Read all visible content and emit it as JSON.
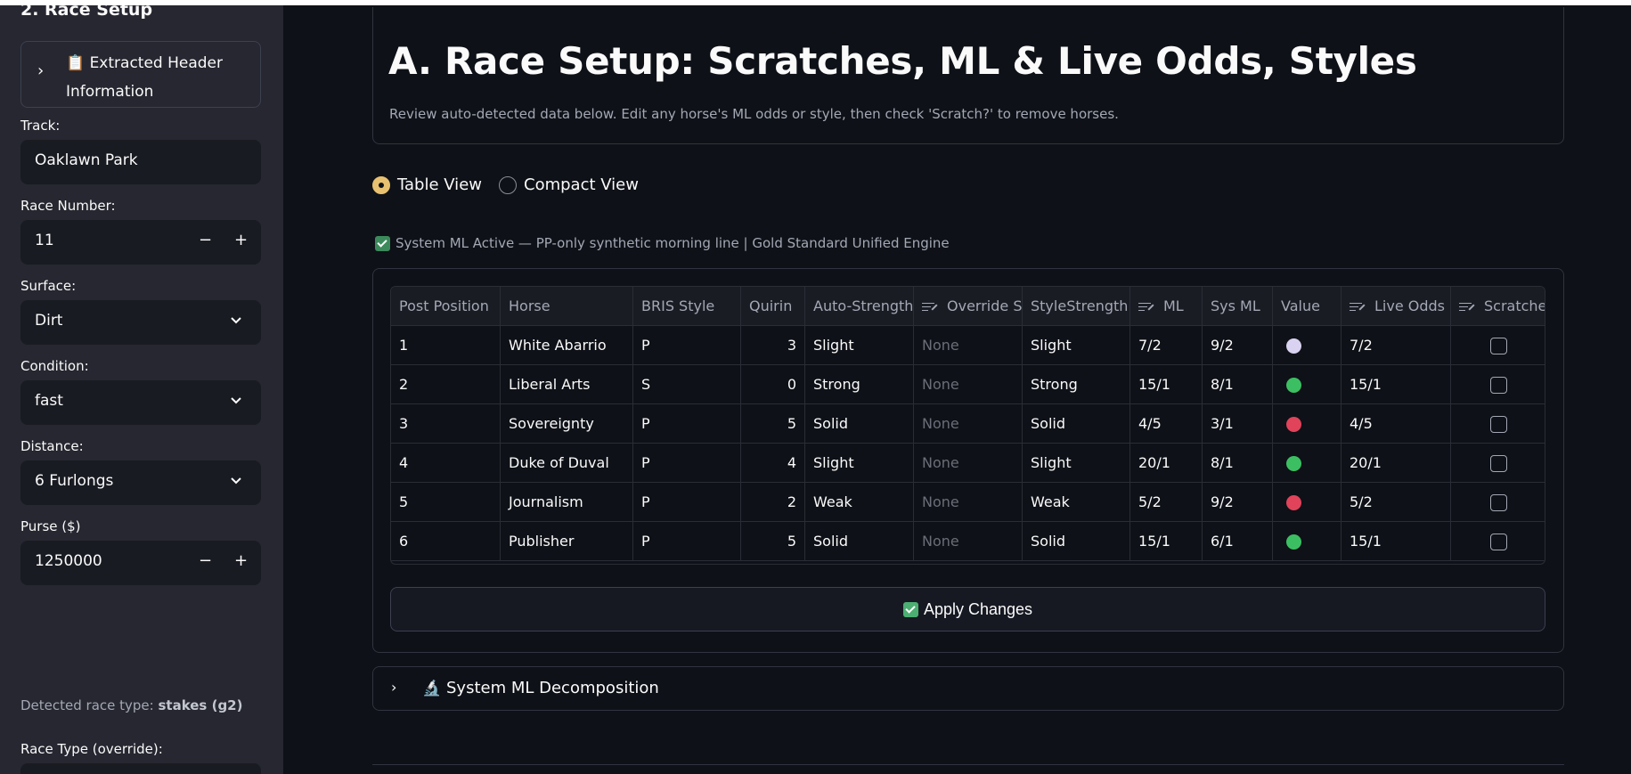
{
  "sidebar": {
    "heading": "2. Race Setup",
    "expander": {
      "icon": "clipboard-icon",
      "label": "📋 Extracted Header Information"
    },
    "track": {
      "label": "Track:",
      "value": "Oaklawn Park"
    },
    "race_number": {
      "label": "Race Number:",
      "value": "11"
    },
    "surface": {
      "label": "Surface:",
      "value": "Dirt"
    },
    "condition": {
      "label": "Condition:",
      "value": "fast"
    },
    "distance": {
      "label": "Distance:",
      "value": "6 Furlongs"
    },
    "purse": {
      "label": "Purse ($)",
      "value": "1250000"
    },
    "stepper": {
      "minus": "−",
      "plus": "+"
    },
    "detected_prefix": "Detected race type: ",
    "detected_value": "stakes (g2)",
    "race_type_label": "Race Type (override):"
  },
  "main": {
    "title": "A. Race Setup: Scratches, ML & Live Odds, Styles",
    "description": "Review auto-detected data below. Edit any horse's ML odds or style, then check 'Scratch?' to remove horses.",
    "view_options": [
      {
        "label": "Table View",
        "selected": true
      },
      {
        "label": "Compact View",
        "selected": false
      }
    ],
    "system_note": "System ML Active — PP-only synthetic morning line | Gold Standard Unified Engine",
    "apply_button": "Apply Changes",
    "decomposition_label": "System ML Decomposition"
  },
  "table": {
    "columns": [
      {
        "key": "post",
        "label": "Post Position",
        "editable": false
      },
      {
        "key": "horse",
        "label": "Horse",
        "editable": false
      },
      {
        "key": "bris",
        "label": "BRIS Style",
        "editable": false
      },
      {
        "key": "quirin",
        "label": "Quirin",
        "editable": false
      },
      {
        "key": "auto",
        "label": "Auto-Strength",
        "editable": false
      },
      {
        "key": "override",
        "label": "Override St",
        "editable": true
      },
      {
        "key": "style",
        "label": "StyleStrength",
        "editable": false
      },
      {
        "key": "ml",
        "label": "ML",
        "editable": true
      },
      {
        "key": "sysml",
        "label": "Sys ML",
        "editable": false
      },
      {
        "key": "value",
        "label": "Value",
        "editable": false
      },
      {
        "key": "live",
        "label": "Live Odds",
        "editable": true
      },
      {
        "key": "scratched",
        "label": "Scratched?",
        "editable": true
      }
    ],
    "rows": [
      {
        "post": "1",
        "horse": "White Abarrio",
        "bris": "P",
        "quirin": "3",
        "auto": "Slight",
        "override": "None",
        "style": "Slight",
        "ml": "7/2",
        "sysml": "9/2",
        "value_color": "#d9d2f0",
        "live": "7/2",
        "scratched": false
      },
      {
        "post": "2",
        "horse": "Liberal Arts",
        "bris": "S",
        "quirin": "0",
        "auto": "Strong",
        "override": "None",
        "style": "Strong",
        "ml": "15/1",
        "sysml": "8/1",
        "value_color": "#3cbf62",
        "live": "15/1",
        "scratched": false
      },
      {
        "post": "3",
        "horse": "Sovereignty",
        "bris": "P",
        "quirin": "5",
        "auto": "Solid",
        "override": "None",
        "style": "Solid",
        "ml": "4/5",
        "sysml": "3/1",
        "value_color": "#e0435a",
        "live": "4/5",
        "scratched": false
      },
      {
        "post": "4",
        "horse": "Duke of Duval",
        "bris": "P",
        "quirin": "4",
        "auto": "Slight",
        "override": "None",
        "style": "Slight",
        "ml": "20/1",
        "sysml": "8/1",
        "value_color": "#3cbf62",
        "live": "20/1",
        "scratched": false
      },
      {
        "post": "5",
        "horse": "Journalism",
        "bris": "P",
        "quirin": "2",
        "auto": "Weak",
        "override": "None",
        "style": "Weak",
        "ml": "5/2",
        "sysml": "9/2",
        "value_color": "#e0435a",
        "live": "5/2",
        "scratched": false
      },
      {
        "post": "6",
        "horse": "Publisher",
        "bris": "P",
        "quirin": "5",
        "auto": "Solid",
        "override": "None",
        "style": "Solid",
        "ml": "15/1",
        "sysml": "6/1",
        "value_color": "#3cbf62",
        "live": "15/1",
        "scratched": false
      }
    ]
  },
  "colors": {
    "accent": "#e8c170",
    "check": "#4caf72"
  }
}
